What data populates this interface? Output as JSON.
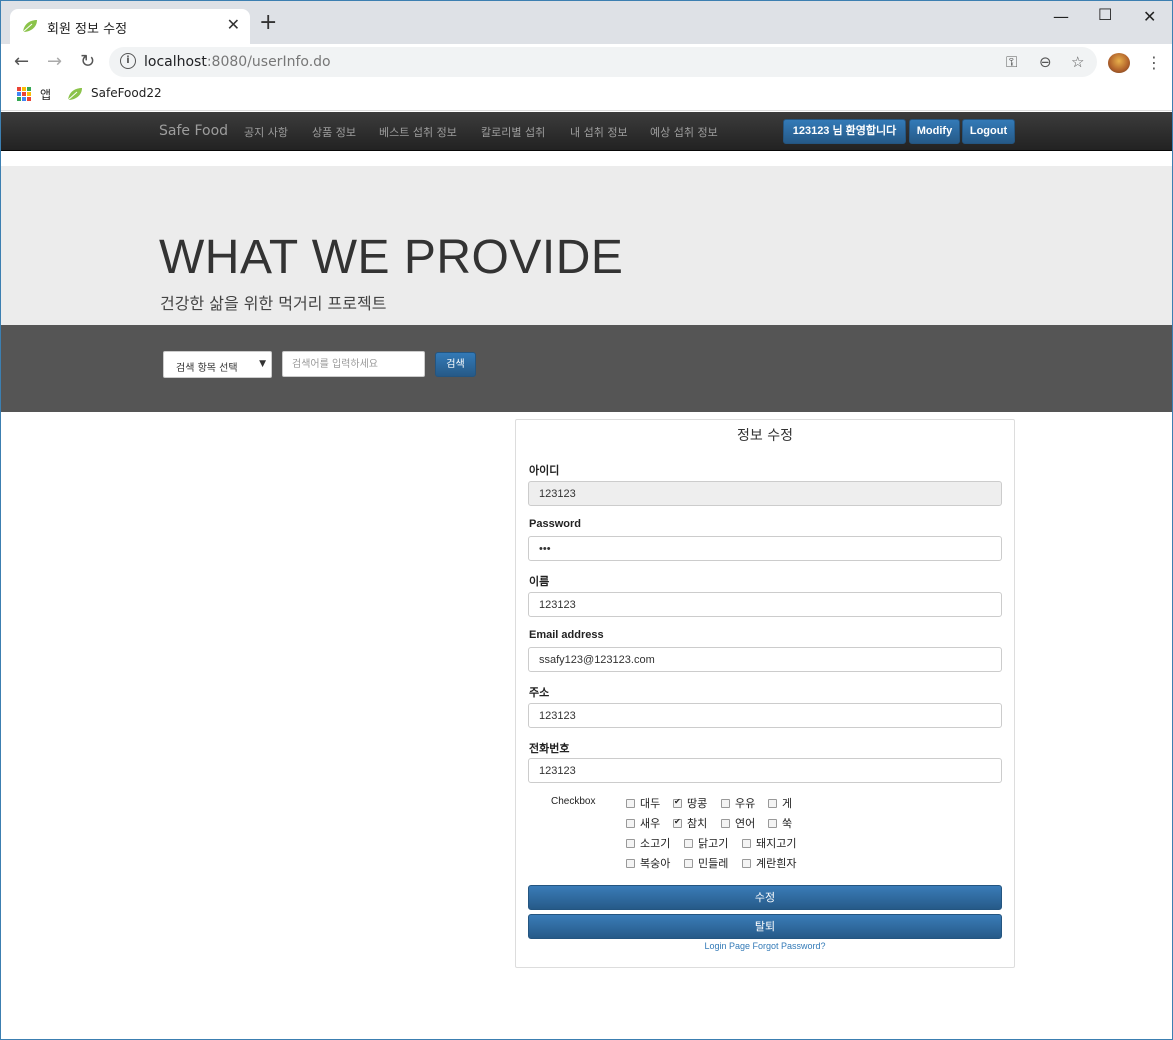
{
  "browser": {
    "tab_title": "회원 정보 수정",
    "url_host": "localhost",
    "url_rest": ":8080/userInfo.do",
    "bookmarks": [
      {
        "label": "앱"
      },
      {
        "label": "SafeFood22"
      }
    ]
  },
  "nav": {
    "brand": "Safe Food",
    "links": [
      "공지 사항",
      "상품 정보",
      "베스트 섭취 정보",
      "칼로리별 섭취",
      "내 섭취 정보",
      "예상 섭취 정보"
    ],
    "welcome": "123123 님 환영합니다",
    "modify": "Modify",
    "logout": "Logout",
    "accent": "#337ab7"
  },
  "hero": {
    "title": "WHAT WE PROVIDE",
    "subtitle": "건강한 삶을 위한 먹거리 프로젝트"
  },
  "search": {
    "select_value": "검색 항목 선택",
    "placeholder": "검색어를 입력하세요",
    "button": "검색"
  },
  "form": {
    "title": "정보 수정",
    "fields": [
      {
        "label": "아이디",
        "value": "123123"
      },
      {
        "label": "Password",
        "value": "•••"
      },
      {
        "label": "이름",
        "value": "123123"
      },
      {
        "label": "Email address",
        "value": "ssafy123@123123.com"
      },
      {
        "label": "주소",
        "value": "123123"
      },
      {
        "label": "전화번호",
        "value": "123123"
      }
    ],
    "checkbox_title": "Checkbox",
    "checkboxes": [
      {
        "label": "대두",
        "checked": false
      },
      {
        "label": "땅콩",
        "checked": true
      },
      {
        "label": "우유",
        "checked": false
      },
      {
        "label": "게",
        "checked": false
      },
      {
        "label": "새우",
        "checked": false
      },
      {
        "label": "참치",
        "checked": true
      },
      {
        "label": "연어",
        "checked": false
      },
      {
        "label": "쑥",
        "checked": false
      },
      {
        "label": "소고기",
        "checked": false
      },
      {
        "label": "닭고기",
        "checked": false
      },
      {
        "label": "돼지고기",
        "checked": false
      },
      {
        "label": "복숭아",
        "checked": false
      },
      {
        "label": "민들레",
        "checked": false
      },
      {
        "label": "계란흰자",
        "checked": false
      }
    ],
    "submit": "수정",
    "withdraw": "탈퇴",
    "links": "Login Page Forgot Password?"
  }
}
